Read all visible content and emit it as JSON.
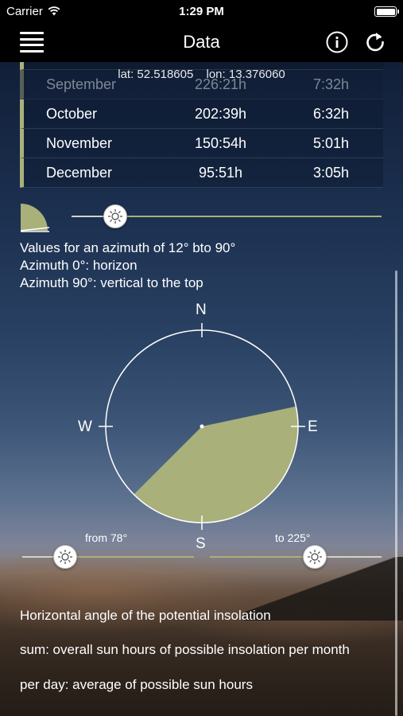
{
  "status_bar": {
    "carrier": "Carrier",
    "time": "1:29 PM"
  },
  "nav": {
    "title": "Data",
    "menu_icon": "hamburger-icon",
    "info_icon": "info-icon",
    "refresh_icon": "refresh-icon"
  },
  "coordinates": {
    "lat": "lat: 52.518605",
    "lon": "lon: 13.376060"
  },
  "table": {
    "rows": [
      {
        "month": "September",
        "sum": "226:21h",
        "per_day": "7:32h"
      },
      {
        "month": "October",
        "sum": "202:39h",
        "per_day": "6:32h"
      },
      {
        "month": "November",
        "sum": "150:54h",
        "per_day": "5:01h"
      },
      {
        "month": "December",
        "sum": "95:51h",
        "per_day": "3:05h"
      }
    ]
  },
  "elevation": {
    "slider_value": 0.14,
    "lines": [
      "Values for an azimuth of 12° bto 90°",
      "Azimuth 0°: horizon",
      "Azimuth 90°: vertical to the top"
    ]
  },
  "compass": {
    "north": "N",
    "south": "S",
    "east": "E",
    "west": "W",
    "from_label": "from 78°",
    "to_label": "to 225°",
    "sector_from_deg": 78,
    "sector_to_deg": 225,
    "sector_color": "#a9b07a"
  },
  "bottom": {
    "heading": "Horizontal angle of the potential insolation",
    "sum_line": "sum: overall sun hours of possible insolation per month",
    "per_day_line": "per day: average of possible sun hours"
  },
  "colors": {
    "accent": "#a9b07a",
    "bar": "#000000"
  }
}
